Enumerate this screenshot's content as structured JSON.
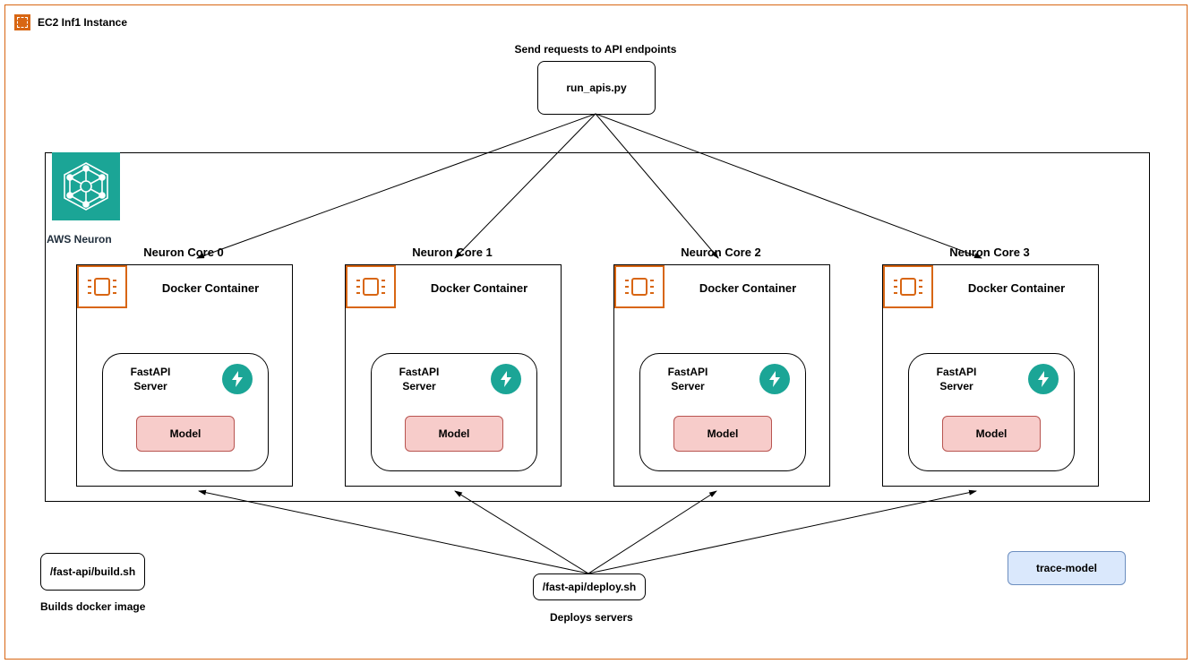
{
  "outer": {
    "title": "EC2 Inf1 Instance"
  },
  "send_label": "Send requests to API endpoints",
  "run_apis": "run_apis.py",
  "neuron_label": "AWS Neuron",
  "cores": [
    {
      "title": "Neuron Core 0",
      "docker": "Docker Container",
      "fastapi_l1": "FastAPI",
      "fastapi_l2": "Server",
      "model": "Model"
    },
    {
      "title": "Neuron Core 1",
      "docker": "Docker Container",
      "fastapi_l1": "FastAPI",
      "fastapi_l2": "Server",
      "model": "Model"
    },
    {
      "title": "Neuron Core 2",
      "docker": "Docker Container",
      "fastapi_l1": "FastAPI",
      "fastapi_l2": "Server",
      "model": "Model"
    },
    {
      "title": "Neuron Core 3",
      "docker": "Docker Container",
      "fastapi_l1": "FastAPI",
      "fastapi_l2": "Server",
      "model": "Model"
    }
  ],
  "build_sh": "/fast-api/build.sh",
  "build_caption": "Builds docker image",
  "deploy_sh": "/fast-api/deploy.sh",
  "deploy_caption": "Deploys servers",
  "trace_model": "trace-model"
}
